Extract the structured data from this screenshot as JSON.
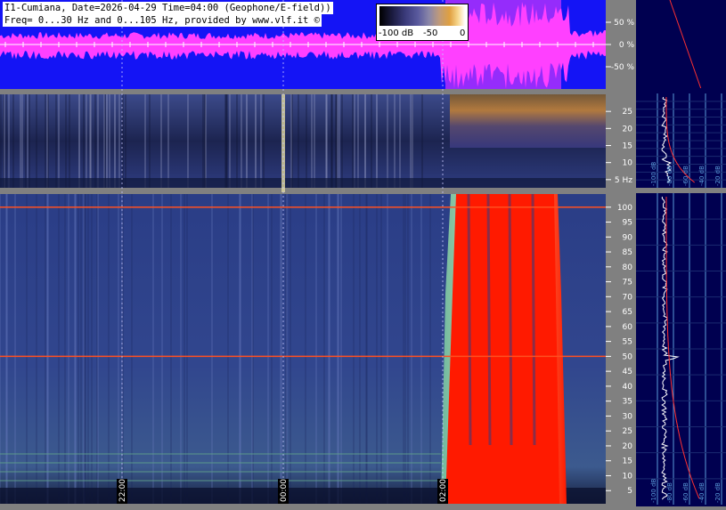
{
  "header": {
    "line1": "I1-Cumiana, Date=2026-04-29 Time=04:00 (Geophone/E-field))",
    "line2": "Freq= 0...30 Hz and 0...105 Hz, provided by www.vlf.it ©"
  },
  "colorbar": {
    "min_label": "-100 dB",
    "mid_label": "-50",
    "max_label": "0"
  },
  "colors": {
    "amplitude_bg": "#1414f5",
    "amplitude_trace": "#ff40ff",
    "spectrogram_bg": "#2a3d86",
    "saturated": "#ff1a00",
    "right_panel_bg": "#000050",
    "grid": "#5a9bd8"
  },
  "chart_data": [
    {
      "type": "area",
      "panel": "amplitude",
      "y_unit": "%",
      "y_ticks": [
        "50 %",
        "0 %",
        "-50 %"
      ],
      "ylim": [
        -100,
        100
      ],
      "x_time_markers": [
        "22:00",
        "00:00",
        "02:00"
      ]
    },
    {
      "type": "heatmap",
      "panel": "spectrogram-geophone",
      "y_unit": "Hz",
      "ylim": [
        0,
        30
      ],
      "y_ticks": [
        {
          "value": 25,
          "label": "25"
        },
        {
          "value": 20,
          "label": "20"
        },
        {
          "value": 15,
          "label": "15"
        },
        {
          "value": 10,
          "label": "10"
        },
        {
          "value": 5,
          "label": "5 Hz"
        }
      ],
      "x_time_markers": [
        "22:00",
        "00:00",
        "02:00"
      ]
    },
    {
      "type": "heatmap",
      "panel": "spectrogram-efield",
      "y_unit": "Hz",
      "ylim": [
        0,
        105
      ],
      "y_ticks": [
        100,
        95,
        90,
        85,
        80,
        75,
        70,
        65,
        60,
        55,
        50,
        45,
        40,
        35,
        30,
        25,
        20,
        15,
        10,
        5
      ],
      "x_time_markers": [
        "22:00",
        "00:00",
        "02:00"
      ],
      "hum_lines_hz": [
        50,
        100
      ]
    },
    {
      "type": "line",
      "panel": "spectrum-top",
      "x_tick_labels": [
        "-100 dB",
        "-80 dB",
        "-60 dB",
        "-40 dB",
        "-20 dB"
      ]
    },
    {
      "type": "line",
      "panel": "spectrum-bottom",
      "x_tick_labels": [
        "-100 dB",
        "-80 dB",
        "-60 dB",
        "-40 dB",
        "-20 dB"
      ]
    }
  ]
}
